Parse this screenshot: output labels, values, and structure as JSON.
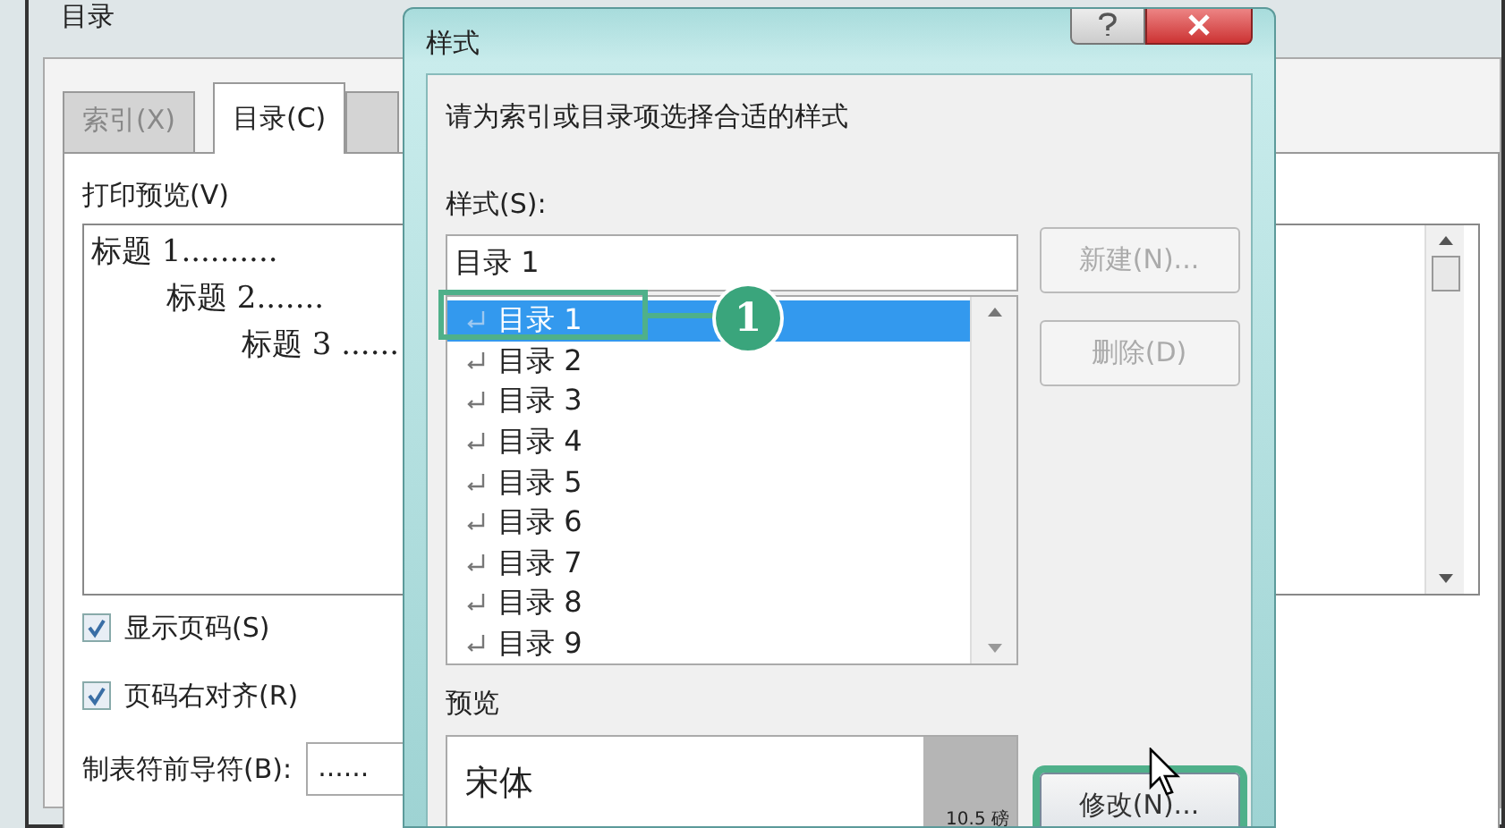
{
  "background_dialog": {
    "title": "目录",
    "tabs": [
      {
        "label": "索引(X)",
        "selected": false
      },
      {
        "label": "目录(C)",
        "selected": true
      },
      {
        "selected": false
      }
    ],
    "print_preview": {
      "label": "打印预览(V)",
      "lines": [
        {
          "text": "标题 1..........",
          "children": [
            {
              "text": "标题 2.......",
              "children": [
                {
                  "text": "标题 3 ......"
                }
              ]
            }
          ]
        }
      ]
    },
    "checkboxes": [
      {
        "label": "显示页码(S)",
        "checked": true
      },
      {
        "label": "页码右对齐(R)",
        "checked": true
      }
    ],
    "leader": {
      "label": "制表符前导符(B):",
      "value": "......"
    }
  },
  "style_dialog": {
    "title": "样式",
    "instruction": "请为索引或目录项选择合适的样式",
    "styles_label": "样式(S):",
    "style_input": "目录 1",
    "styles": [
      {
        "text": "目录 1",
        "selected": true
      },
      {
        "text": "目录 2",
        "selected": false
      },
      {
        "text": "目录 3",
        "selected": false
      },
      {
        "text": "目录 4",
        "selected": false
      },
      {
        "text": "目录 5",
        "selected": false
      },
      {
        "text": "目录 6",
        "selected": false
      },
      {
        "text": "目录 7",
        "selected": false
      },
      {
        "text": "目录 8",
        "selected": false
      },
      {
        "text": "目录 9",
        "selected": false
      }
    ],
    "buttons": [
      {
        "label": "新建(N)...",
        "disabled": true
      },
      {
        "label": "删除(D)",
        "disabled": true
      }
    ],
    "preview_label": "预览",
    "preview": {
      "font_name": "宋体",
      "size": "10.5 磅"
    },
    "modify_button": {
      "label": "修改(N)...",
      "highlighted": true
    },
    "callout": {
      "label": "1"
    }
  }
}
